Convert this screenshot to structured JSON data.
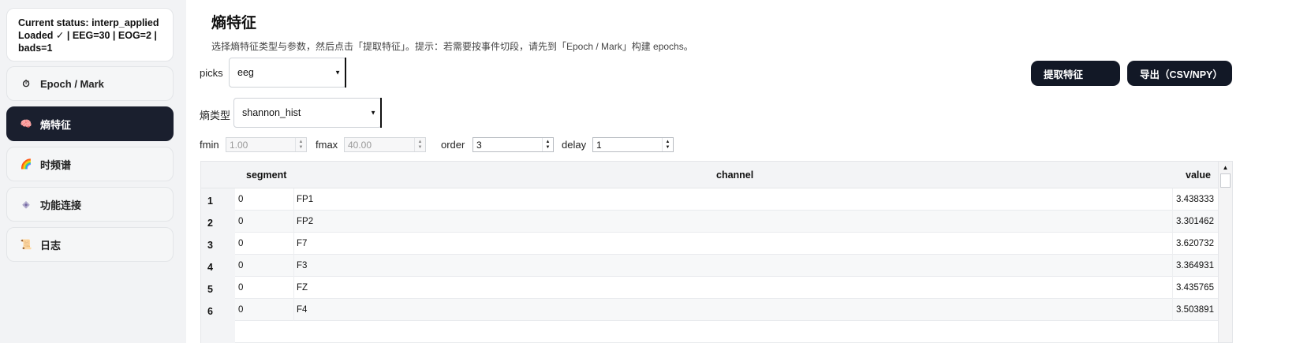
{
  "sidebar": {
    "status_line1": "Current status: interp_applied",
    "status_line2": "Loaded ✓ | EEG=30 | EOG=2 |",
    "status_line3": "bads=1",
    "items": [
      {
        "icon": "⏱",
        "icon_name": "stopwatch-icon",
        "label": "Epoch / Mark",
        "active": false
      },
      {
        "icon": "🧠",
        "icon_name": "brain-icon",
        "label": "熵特征",
        "active": true
      },
      {
        "icon": "🌈",
        "icon_name": "rainbow-icon",
        "label": "时频谱",
        "active": false
      },
      {
        "icon": "◈",
        "icon_name": "connectivity-icon",
        "label": "功能连接",
        "active": false
      },
      {
        "icon": "📜",
        "icon_name": "scroll-icon",
        "label": "日志",
        "active": false
      }
    ]
  },
  "main": {
    "title": "熵特征",
    "hint": "选择熵特征类型与参数，然后点击「提取特征」。提示：若需要按事件切段，请先到「Epoch / Mark」构建 epochs。",
    "picks_label": "picks",
    "picks_value": "eeg",
    "entropy_label": "熵类型",
    "entropy_value": "shannon_hist",
    "extract_button": "提取特征",
    "export_button": "导出（CSV/NPY）",
    "params": {
      "fmin_label": "fmin",
      "fmin_value": "1.00",
      "fmax_label": "fmax",
      "fmax_value": "40.00",
      "order_label": "order",
      "order_value": "3",
      "delay_label": "delay",
      "delay_value": "1"
    },
    "table": {
      "columns": [
        "segment",
        "channel",
        "value"
      ],
      "rows": [
        {
          "index": "1",
          "segment": "0",
          "channel": "FP1",
          "value": "3.438333"
        },
        {
          "index": "2",
          "segment": "0",
          "channel": "FP2",
          "value": "3.301462"
        },
        {
          "index": "3",
          "segment": "0",
          "channel": "F7",
          "value": "3.620732"
        },
        {
          "index": "4",
          "segment": "0",
          "channel": "F3",
          "value": "3.364931"
        },
        {
          "index": "5",
          "segment": "0",
          "channel": "FZ",
          "value": "3.435765"
        },
        {
          "index": "6",
          "segment": "0",
          "channel": "F4",
          "value": "3.503891"
        }
      ]
    }
  }
}
